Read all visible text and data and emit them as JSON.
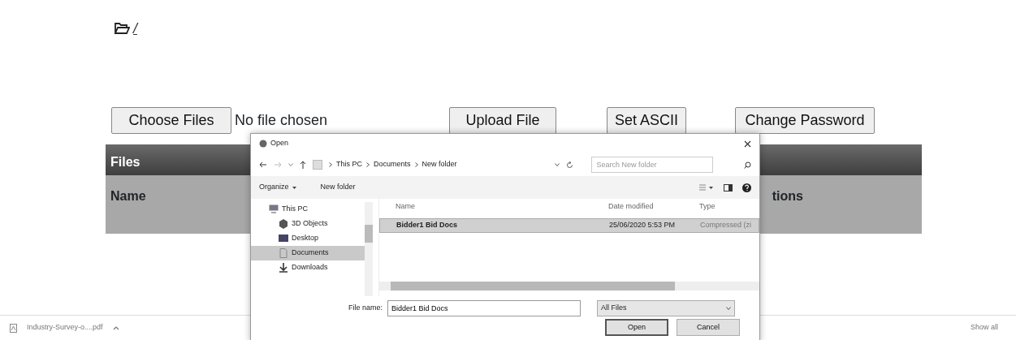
{
  "folder_link": {
    "text": "/"
  },
  "upload_bar": {
    "choose_button": "Choose Files",
    "file_status": "No file chosen",
    "buttons": [
      "Upload File",
      "Set ASCII",
      "Change Password"
    ]
  },
  "files_table": {
    "title": "Files",
    "columns": [
      "Name",
      "tions"
    ]
  },
  "download_bar": {
    "items": [
      {
        "name": "Industry-Survey-o....pdf"
      }
    ],
    "show_all": "Show all"
  },
  "dialog": {
    "title": "Open",
    "breadcrumb": [
      "This PC",
      "Documents",
      "New folder"
    ],
    "search": {
      "placeholder": "Search New folder"
    },
    "toolbar": {
      "organize": "Organize",
      "new_folder": "New folder"
    },
    "nav": [
      {
        "label": "This PC",
        "kind": "pc",
        "selected": false,
        "children": [
          {
            "label": "3D Objects",
            "kind": "cube",
            "selected": false
          },
          {
            "label": "Desktop",
            "kind": "desktop",
            "selected": false
          },
          {
            "label": "Documents",
            "kind": "documents",
            "selected": true
          },
          {
            "label": "Downloads",
            "kind": "downloads",
            "selected": false
          }
        ]
      }
    ],
    "columns": [
      "Name",
      "Date modified",
      "Type"
    ],
    "files": [
      {
        "name": "Bidder1 Bid Docs",
        "date": "25/06/2020 5:53 PM",
        "type": "Compressed (zi",
        "selected": true
      }
    ],
    "file_name": {
      "label": "File name:",
      "value": "Bidder1 Bid Docs"
    },
    "filter": "All Files",
    "buttons": [
      {
        "label": "Open",
        "default": true
      },
      {
        "label": "Cancel",
        "default": false
      }
    ]
  }
}
